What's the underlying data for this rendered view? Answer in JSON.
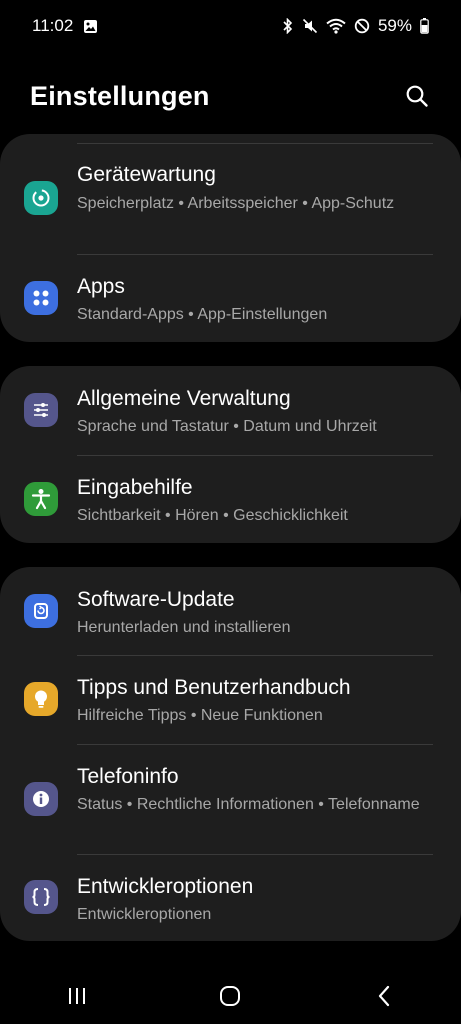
{
  "status_bar": {
    "time": "11:02",
    "battery": "59%",
    "icons": [
      "image-icon",
      "bluetooth-icon",
      "mute-icon",
      "wifi-icon",
      "dnd-icon",
      "battery-icon"
    ]
  },
  "header": {
    "title": "Einstellungen",
    "search_icon": "search-icon"
  },
  "groups": [
    {
      "items": [
        {
          "title": "Gerätewartung",
          "subtitle": "Speicherplatz  •  Arbeitsspeicher  •  App-Schutz",
          "icon": "device-care-icon",
          "color": "#1aa592"
        },
        {
          "title": "Apps",
          "subtitle": "Standard-Apps  •  App-Einstellungen",
          "icon": "apps-icon",
          "color": "#3d6fe0"
        }
      ]
    },
    {
      "items": [
        {
          "title": "Allgemeine Verwaltung",
          "subtitle": "Sprache und Tastatur  •  Datum und Uhrzeit",
          "icon": "sliders-icon",
          "color": "#55568c"
        },
        {
          "title": "Eingabehilfe",
          "subtitle": "Sichtbarkeit  •  Hören  •  Geschicklichkeit",
          "icon": "accessibility-icon",
          "color": "#2f9b39"
        }
      ]
    },
    {
      "items": [
        {
          "title": "Software-Update",
          "subtitle": "Herunterladen und installieren",
          "icon": "software-update-icon",
          "color": "#3d6fe0"
        },
        {
          "title": "Tipps und Benutzerhandbuch",
          "subtitle": "Hilfreiche Tipps  •  Neue Funktionen",
          "icon": "lightbulb-icon",
          "color": "#e6a82a"
        },
        {
          "title": "Telefoninfo",
          "subtitle": "Status  •  Rechtliche Informationen  •  Telefonname",
          "icon": "info-icon",
          "color": "#55568c"
        },
        {
          "title": "Entwickleroptionen",
          "subtitle": "Entwickleroptionen",
          "icon": "code-braces-icon",
          "color": "#55568c"
        }
      ]
    }
  ],
  "nav_bar": {
    "recents": "recents-icon",
    "home": "home-icon",
    "back": "back-icon"
  }
}
